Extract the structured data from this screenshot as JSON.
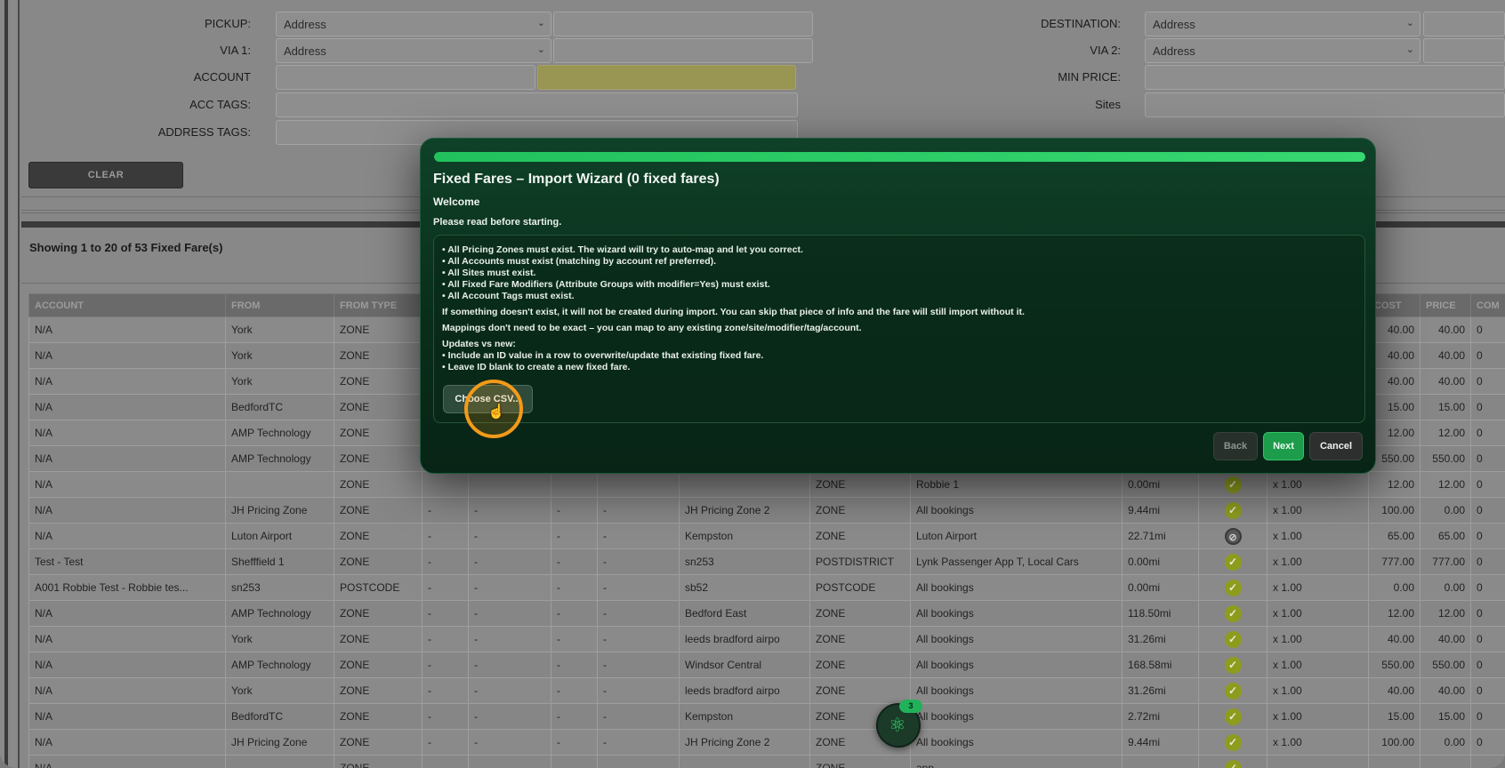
{
  "filters": {
    "pickup_label": "PICKUP:",
    "pickup_value": "Address",
    "destination_label": "DESTINATION:",
    "destination_value": "Address",
    "via1_label": "VIA 1:",
    "via1_value": "Address",
    "via2_label": "VIA 2:",
    "via2_value": "Address",
    "account_label": "ACCOUNT",
    "min_price_label": "MIN PRICE:",
    "acc_tags_label": "ACC TAGS:",
    "sites_label": "Sites",
    "address_tags_label": "ADDRESS TAGS:",
    "clear_label": "CLEAR"
  },
  "results": {
    "title": "Showing 1 to 20 of 53 Fixed Fare(s)",
    "columns": [
      "ACCOUNT",
      "FROM",
      "FROM TYPE",
      "",
      "",
      "",
      "",
      "",
      "",
      "",
      "",
      "",
      "",
      "COST",
      "PRICE",
      "COM"
    ],
    "rows": [
      [
        "N/A",
        "York",
        "ZONE",
        "",
        "",
        "",
        "",
        "",
        "",
        "",
        "",
        "",
        "",
        "40.00",
        "40.00",
        "0"
      ],
      [
        "N/A",
        "York",
        "ZONE",
        "",
        "",
        "",
        "",
        "",
        "",
        "",
        "",
        "",
        "",
        "40.00",
        "40.00",
        "0"
      ],
      [
        "N/A",
        "York",
        "ZONE",
        "",
        "",
        "",
        "",
        "",
        "",
        "",
        "",
        "",
        "",
        "40.00",
        "40.00",
        "0"
      ],
      [
        "N/A",
        "BedfordTC",
        "ZONE",
        "",
        "",
        "",
        "",
        "",
        "",
        "",
        "",
        "",
        "",
        "15.00",
        "15.00",
        "0"
      ],
      [
        "N/A",
        "AMP Technology",
        "ZONE",
        "",
        "",
        "",
        "",
        "",
        "",
        "",
        "",
        "",
        "",
        "12.00",
        "12.00",
        "0"
      ],
      [
        "N/A",
        "AMP Technology",
        "ZONE",
        "",
        "",
        "",
        "",
        "",
        "",
        "",
        "",
        "",
        "",
        "550.00",
        "550.00",
        "0"
      ],
      [
        "N/A",
        "",
        "ZONE",
        "",
        "",
        "",
        "",
        "",
        "ZONE",
        "Robbie 1",
        "0.00mi",
        "check",
        "x 1.00",
        "12.00",
        "12.00",
        "0"
      ],
      [
        "N/A",
        "JH Pricing Zone",
        "ZONE",
        "-",
        "-",
        "-",
        "-",
        "JH Pricing Zone 2",
        "ZONE",
        "All bookings",
        "9.44mi",
        "check",
        "x 1.00",
        "100.00",
        "0.00",
        "0"
      ],
      [
        "N/A",
        "Luton Airport",
        "ZONE",
        "-",
        "-",
        "-",
        "-",
        "Kempston",
        "ZONE",
        "Luton Airport",
        "22.71mi",
        "block",
        "x 1.00",
        "65.00",
        "65.00",
        "0"
      ],
      [
        "Test - Test",
        "Shefffield 1",
        "ZONE",
        "-",
        "-",
        "-",
        "-",
        "sn253",
        "POSTDISTRICT",
        "Lynk Passenger App T, Local Cars",
        "0.00mi",
        "check",
        "x 1.00",
        "777.00",
        "777.00",
        "0"
      ],
      [
        "A001 Robbie Test - Robbie tes...",
        "sn253",
        "POSTCODE",
        "-",
        "-",
        "-",
        "-",
        "sb52",
        "POSTCODE",
        "All bookings",
        "0.00mi",
        "check",
        "x 1.00",
        "0.00",
        "0.00",
        "0"
      ],
      [
        "N/A",
        "AMP Technology",
        "ZONE",
        "-",
        "-",
        "-",
        "-",
        "Bedford East",
        "ZONE",
        "All bookings",
        "118.50mi",
        "check",
        "x 1.00",
        "12.00",
        "12.00",
        "0"
      ],
      [
        "N/A",
        "York",
        "ZONE",
        "-",
        "-",
        "-",
        "-",
        "leeds bradford airpo",
        "ZONE",
        "All bookings",
        "31.26mi",
        "check",
        "x 1.00",
        "40.00",
        "40.00",
        "0"
      ],
      [
        "N/A",
        "AMP Technology",
        "ZONE",
        "-",
        "-",
        "-",
        "-",
        "Windsor Central",
        "ZONE",
        "All bookings",
        "168.58mi",
        "check",
        "x 1.00",
        "550.00",
        "550.00",
        "0"
      ],
      [
        "N/A",
        "York",
        "ZONE",
        "-",
        "-",
        "-",
        "-",
        "leeds bradford airpo",
        "ZONE",
        "All bookings",
        "31.26mi",
        "check",
        "x 1.00",
        "40.00",
        "40.00",
        "0"
      ],
      [
        "N/A",
        "BedfordTC",
        "ZONE",
        "-",
        "-",
        "-",
        "-",
        "Kempston",
        "ZONE",
        "All bookings",
        "2.72mi",
        "check",
        "x 1.00",
        "15.00",
        "15.00",
        "0"
      ],
      [
        "N/A",
        "JH Pricing Zone",
        "ZONE",
        "-",
        "-",
        "-",
        "-",
        "JH Pricing Zone 2",
        "ZONE",
        "All bookings",
        "9.44mi",
        "check",
        "x 1.00",
        "100.00",
        "0.00",
        "0"
      ],
      [
        "N/A",
        "",
        "ZONE",
        "",
        "",
        "",
        "",
        "",
        "ZONE",
        "app",
        "",
        "check",
        "",
        "",
        "",
        ""
      ]
    ]
  },
  "wizard": {
    "progress": 1.0,
    "title": "Fixed Fares – Import Wizard (0 fixed fares)",
    "step": "Welcome",
    "intro": "Please read before starting.",
    "lines": [
      "• All Pricing Zones must exist. The wizard will try to auto-map and let you correct.",
      "• All Accounts must exist (matching by account ref preferred).",
      "• All Sites must exist.",
      "• All Fixed Fare Modifiers (Attribute Groups with modifier=Yes) must exist.",
      "• All Account Tags must exist.",
      "If something doesn't exist, it will not be created during import. You can skip that piece of info and the fare will still import without it.",
      "Mappings don't need to be exact – you can map to any existing zone/site/modifier/tag/account.",
      "Updates vs new:",
      "• Include an ID value in a row to overwrite/update that existing fixed fare.",
      "• Leave ID blank to create a new fixed fare."
    ],
    "choose_label": "Choose CSV...",
    "back_label": "Back",
    "next_label": "Next",
    "cancel_label": "Cancel"
  },
  "fab": {
    "badge": "3"
  },
  "colors": {
    "accent": "#21c25d",
    "modal_bg": "#0f4128",
    "check": "#8e9c1e"
  }
}
